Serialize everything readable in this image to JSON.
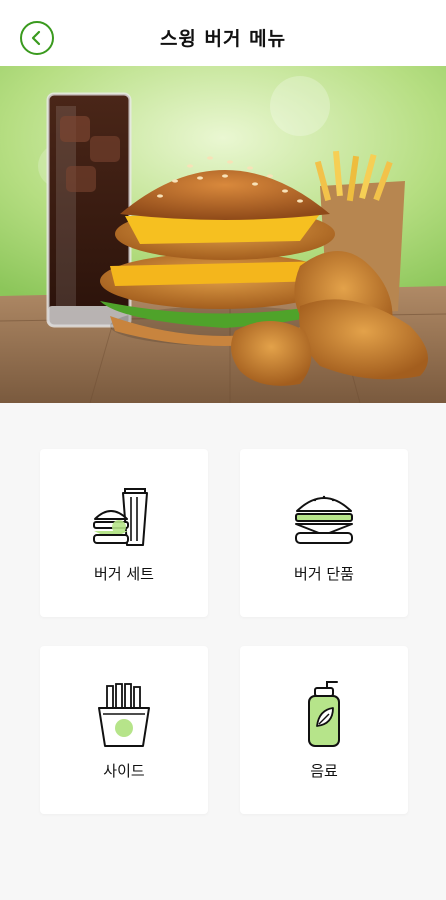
{
  "header": {
    "title": "스윙 버거 메뉴",
    "back_icon": "chevron-left-icon"
  },
  "colors": {
    "accent": "#3a9a1e",
    "icon_highlight": "#b6e48a",
    "background": "#f7f7f7"
  },
  "menu": {
    "items": [
      {
        "label": "버거 세트",
        "icon": "burger-set-icon"
      },
      {
        "label": "버거 단품",
        "icon": "burger-icon"
      },
      {
        "label": "사이드",
        "icon": "fries-icon"
      },
      {
        "label": "음료",
        "icon": "drink-bottle-icon"
      }
    ]
  }
}
